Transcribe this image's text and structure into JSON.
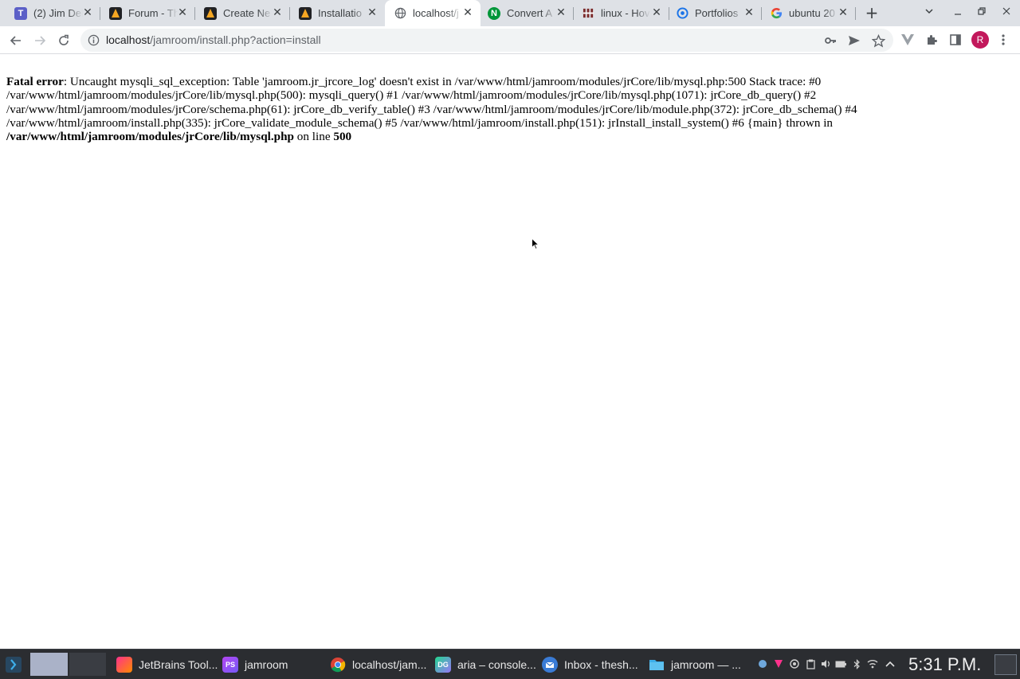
{
  "browser": {
    "tabs": [
      {
        "title": "(2) Jim Del",
        "favicon": "teams-icon",
        "favicon_color": "#5b5fc7"
      },
      {
        "title": "Forum - Th",
        "favicon": "jamroom-icon",
        "favicon_color": "#202124"
      },
      {
        "title": "Create Ne",
        "favicon": "jamroom-icon",
        "favicon_color": "#202124"
      },
      {
        "title": "Installatio",
        "favicon": "jamroom-icon",
        "favicon_color": "#202124"
      },
      {
        "title": "localhost/j",
        "favicon": "globe-icon",
        "favicon_color": "#5f6368",
        "active": true
      },
      {
        "title": "Convert A",
        "favicon": "nginx-icon",
        "favicon_color": "#009639"
      },
      {
        "title": "linux - Hov",
        "favicon": "superuser-icon",
        "favicon_color": "#7b2a2a"
      },
      {
        "title": "Portfolios",
        "favicon": "portfolio-icon",
        "favicon_color": "#1a73e8"
      },
      {
        "title": "ubuntu 20",
        "favicon": "google-icon",
        "favicon_color": "#4285f4"
      }
    ],
    "url": {
      "host": "localhost",
      "path": "/jamroom/install.php?action=install"
    },
    "profile_initial": "R",
    "profile_color": "#c2185b"
  },
  "page": {
    "error_label": "Fatal error",
    "error_message": ": Uncaught mysqli_sql_exception: Table 'jamroom.jr_jrcore_log' doesn't exist in /var/www/html/jamroom/modules/jrCore/lib/mysql.php:500 Stack trace: #0 /var/www/html/jamroom/modules/jrCore/lib/mysql.php(500): mysqli_query() #1 /var/www/html/jamroom/modules/jrCore/lib/mysql.php(1071): jrCore_db_query() #2 /var/www/html/jamroom/modules/jrCore/schema.php(61): jrCore_db_verify_table() #3 /var/www/html/jamroom/modules/jrCore/lib/module.php(372): jrCore_db_schema() #4 /var/www/html/jamroom/install.php(335): jrCore_validate_module_schema() #5 /var/www/html/jamroom/install.php(151): jrInstall_install_system() #6 {main} thrown in ",
    "error_file": "/var/www/html/jamroom/modules/jrCore/lib/mysql.php",
    "on_line_text": " on line ",
    "error_line": "500"
  },
  "taskbar": {
    "tasks": [
      {
        "label": "JetBrains Tool...",
        "icon": "jetbrains-toolbox-icon",
        "color": "#e5396b"
      },
      {
        "label": "jamroom",
        "icon": "phpstorm-icon",
        "color": "#8f47e0"
      },
      {
        "label": "localhost/jam...",
        "icon": "chrome-icon",
        "color": "#34a853"
      },
      {
        "label": "aria – console...",
        "icon": "datagrip-icon",
        "color": "#22d88f"
      },
      {
        "label": "Inbox - thesh...",
        "icon": "thunderbird-icon",
        "color": "#3a7bd5"
      },
      {
        "label": "jamroom — ...",
        "icon": "dolphin-folder-icon",
        "color": "#3daee9"
      }
    ],
    "clock": "5:31 P.M."
  }
}
